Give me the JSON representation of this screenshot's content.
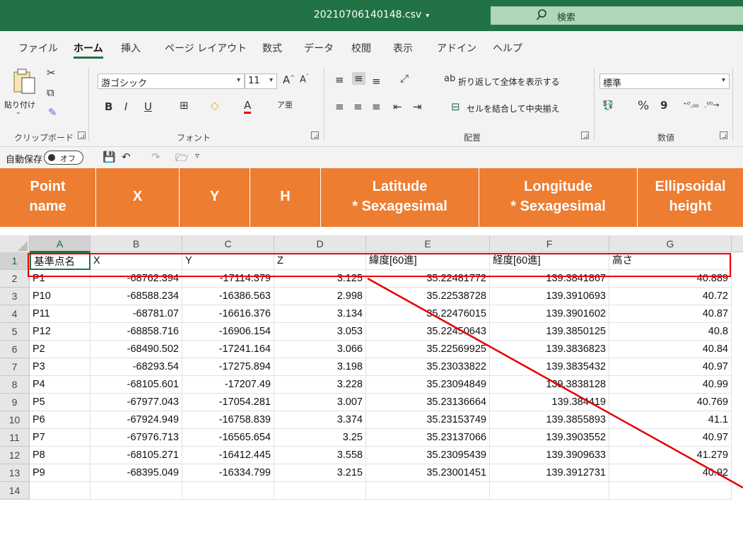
{
  "window": {
    "filename": "20210706140148.csv",
    "search_label": "検索"
  },
  "menu": {
    "tabs": [
      "ファイル",
      "ホーム",
      "挿入",
      "ページ レイアウト",
      "数式",
      "データ",
      "校閲",
      "表示",
      "アドイン",
      "ヘルプ"
    ],
    "active_tab": "ホーム"
  },
  "ribbon": {
    "clipboard": {
      "paste_label": "貼り付け",
      "group_label": "クリップボード"
    },
    "font": {
      "font_name": "游ゴシック",
      "font_size": "11",
      "bold": "B",
      "italic": "I",
      "underline": "U",
      "group_label": "フォント"
    },
    "alignment": {
      "wrap_text": "折り返して全体を表示する",
      "merge_center": "セルを結合して中央揃え",
      "group_label": "配置"
    },
    "number": {
      "format": "標準",
      "percent": "%",
      "comma": "9",
      "group_label": "数値"
    }
  },
  "qat": {
    "autosave_label": "自動保存",
    "autosave_state": "オフ"
  },
  "overlay_headers": [
    {
      "line1": "Point",
      "line2": "name"
    },
    {
      "line1": "X",
      "line2": ""
    },
    {
      "line1": "Y",
      "line2": ""
    },
    {
      "line1": "H",
      "line2": ""
    },
    {
      "line1": "Latitude",
      "line2": "* Sexagesimal"
    },
    {
      "line1": "Longitude",
      "line2": "* Sexagesimal"
    },
    {
      "line1": "Ellipsoidal",
      "line2": "height"
    }
  ],
  "sheet": {
    "columns": [
      "A",
      "B",
      "C",
      "D",
      "E",
      "F",
      "G"
    ],
    "header_row": [
      "基準点名",
      "X",
      "Y",
      "Z",
      "緯度[60進]",
      "経度[60進]",
      "高さ"
    ],
    "rows": [
      [
        "P1",
        "-68762.394",
        "-17114.379",
        "3.125",
        "35.22481772",
        "139.3841867",
        "40.889"
      ],
      [
        "P10",
        "-68588.234",
        "-16386.563",
        "2.998",
        "35.22538728",
        "139.3910693",
        "40.72"
      ],
      [
        "P11",
        "-68781.07",
        "-16616.376",
        "3.134",
        "35.22476015",
        "139.3901602",
        "40.87"
      ],
      [
        "P12",
        "-68858.716",
        "-16906.154",
        "3.053",
        "35.22450643",
        "139.3850125",
        "40.8"
      ],
      [
        "P2",
        "-68490.502",
        "-17241.164",
        "3.066",
        "35.22569925",
        "139.3836823",
        "40.84"
      ],
      [
        "P3",
        "-68293.54",
        "-17275.894",
        "3.198",
        "35.23033822",
        "139.3835432",
        "40.97"
      ],
      [
        "P4",
        "-68105.601",
        "-17207.49",
        "3.228",
        "35.23094849",
        "139.3838128",
        "40.99"
      ],
      [
        "P5",
        "-67977.043",
        "-17054.281",
        "3.007",
        "35.23136664",
        "139.384419",
        "40.769"
      ],
      [
        "P6",
        "-67924.949",
        "-16758.839",
        "3.374",
        "35.23153749",
        "139.3855893",
        "41.1"
      ],
      [
        "P7",
        "-67976.713",
        "-16565.654",
        "3.25",
        "35.23137066",
        "139.3903552",
        "40.97"
      ],
      [
        "P8",
        "-68105.271",
        "-16412.445",
        "3.558",
        "35.23095439",
        "139.3909633",
        "41.279"
      ],
      [
        "P9",
        "-68395.049",
        "-16334.799",
        "3.215",
        "35.23001451",
        "139.3912731",
        "40.92"
      ]
    ],
    "row_numbers": [
      "1",
      "2",
      "3",
      "4",
      "5",
      "6",
      "7",
      "8",
      "9",
      "10",
      "11",
      "12",
      "13",
      "14"
    ]
  },
  "colors": {
    "excel_green": "#217346",
    "header_orange": "#ed7d31",
    "annotation_red": "#e00000"
  }
}
